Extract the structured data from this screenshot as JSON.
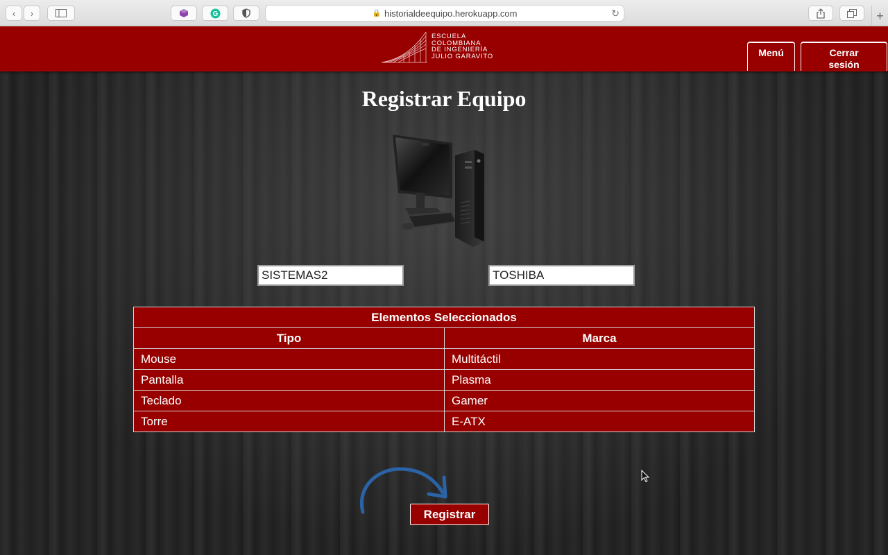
{
  "browser": {
    "url": "historialdeequipo.herokuapp.com",
    "back_icon": "‹",
    "forward_icon": "›",
    "plus_icon": "+"
  },
  "header": {
    "logo_lines": [
      "Escuela",
      "Colombiana",
      "de Ingeniería",
      "Julio Garavito"
    ],
    "menu_label": "Menú",
    "logout_label_line1": "Cerrar",
    "logout_label_line2": "sesión"
  },
  "main": {
    "title": "Registrar Equipo",
    "field_left_value": "SISTEMAS2",
    "field_right_value": "TOSHIBA",
    "table": {
      "caption": "Elementos Seleccionados",
      "columns": [
        "Tipo",
        "Marca"
      ],
      "rows": [
        [
          "Mouse",
          "Multitáctil"
        ],
        [
          "Pantalla",
          "Plasma"
        ],
        [
          "Teclado",
          "Gamer"
        ],
        [
          "Torre",
          "E-ATX"
        ]
      ]
    },
    "submit_label": "Registrar"
  },
  "colors": {
    "brand_red": "#980000",
    "arrow_blue": "#2b63a7"
  }
}
